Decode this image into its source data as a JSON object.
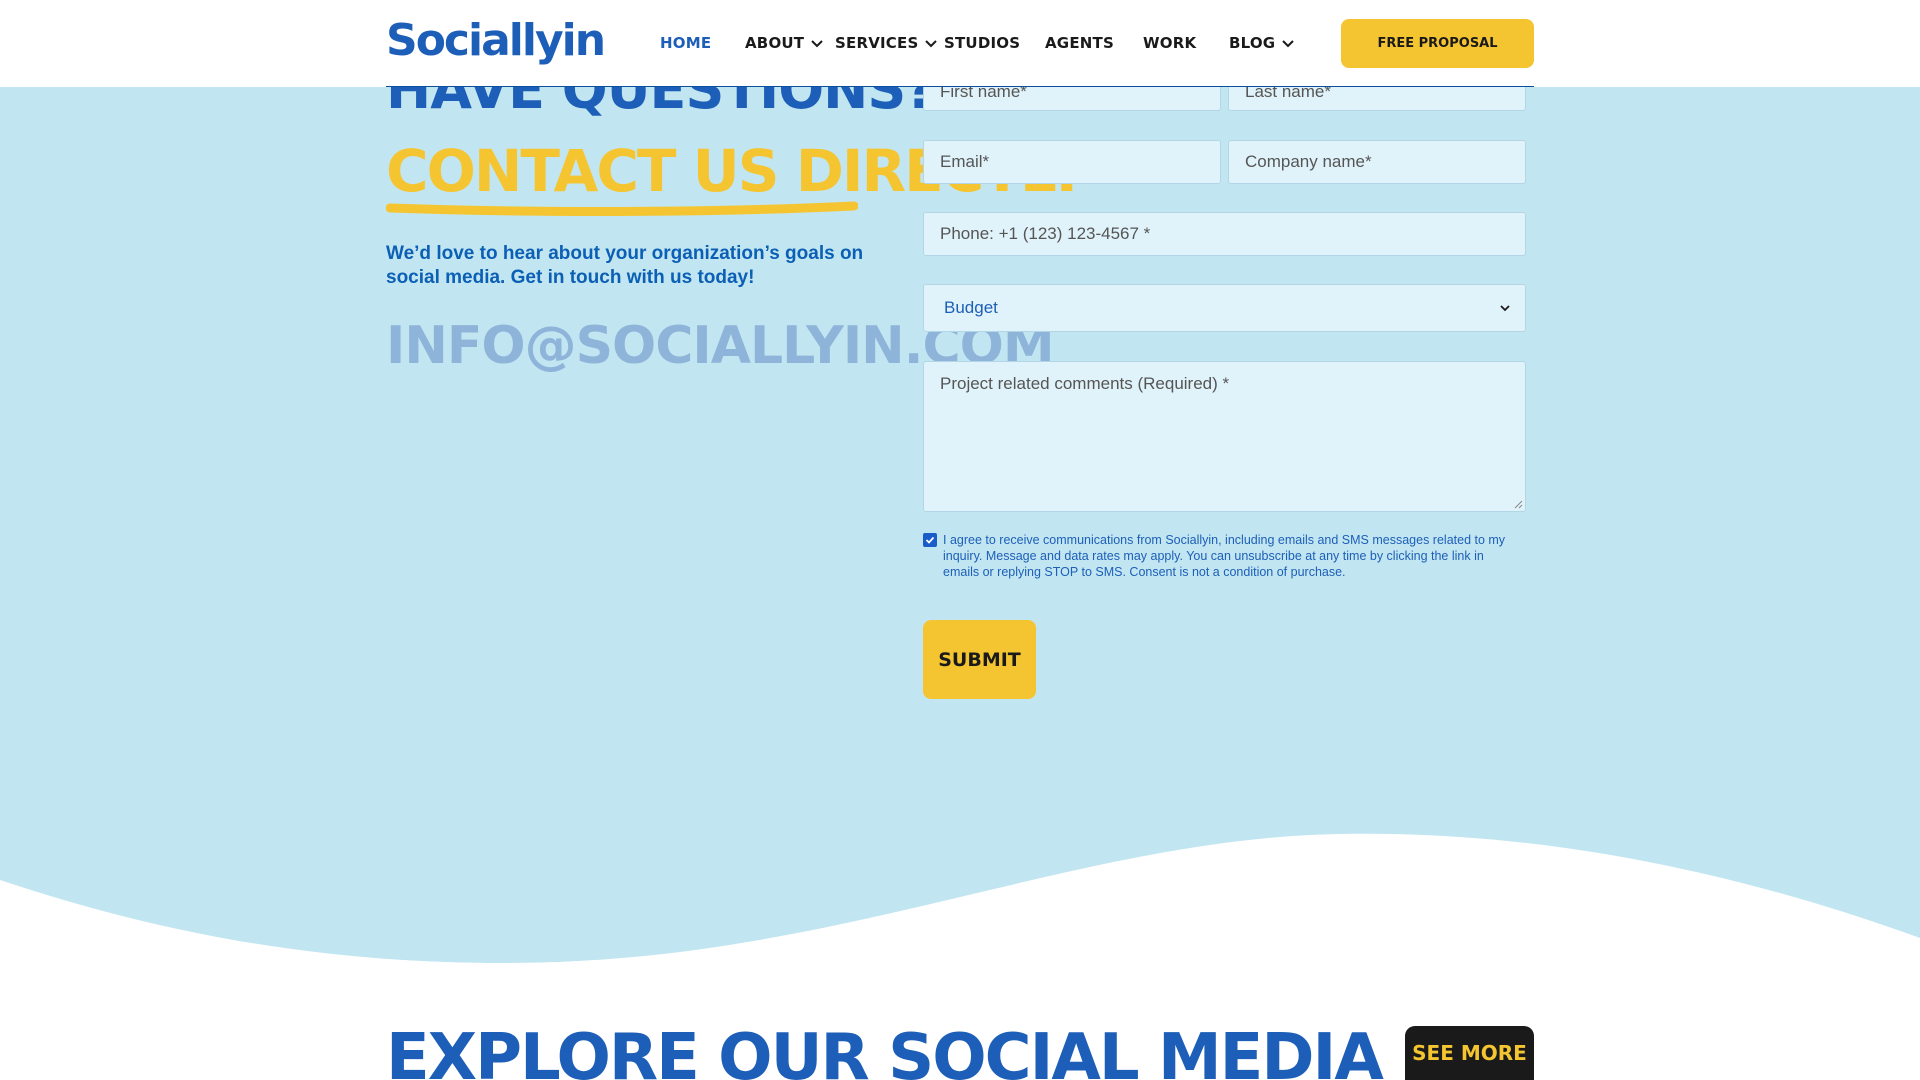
{
  "header": {
    "logo_text": "Sociallyin",
    "nav": [
      {
        "label": "HOME",
        "active": true,
        "dropdown": false
      },
      {
        "label": "ABOUT",
        "active": false,
        "dropdown": true
      },
      {
        "label": "SERVICES",
        "active": false,
        "dropdown": true
      },
      {
        "label": "STUDIOS",
        "active": false,
        "dropdown": false
      },
      {
        "label": "AGENTS",
        "active": false,
        "dropdown": false
      },
      {
        "label": "WORK",
        "active": false,
        "dropdown": false
      },
      {
        "label": "BLOG",
        "active": false,
        "dropdown": true
      }
    ],
    "cta_label": "FREE PROPOSAL"
  },
  "contact": {
    "heading_line1": "HAVE QUESTIONS?",
    "heading_line2": "CONTACT US DIRECTLY",
    "intro": "We’d love to hear about your organization’s goals on social media. Get in touch with us today!",
    "email": "INFO@SOCIALLYIN.COM"
  },
  "form": {
    "first_name_placeholder": "First name*",
    "last_name_placeholder": "Last name*",
    "email_placeholder": "Email*",
    "company_placeholder": "Company name*",
    "phone_placeholder": "Phone: +1 (123) 123-4567 *",
    "budget_selected": "Budget",
    "comments_placeholder": "Project related comments (Required) *",
    "consent_checked": true,
    "consent_text": "I agree to receive communications from Sociallyin, including emails and SMS messages related to my inquiry. Message and data rates may apply. You can unsubscribe at any time by clicking the link in emails or replying STOP to SMS. Consent is not a condition of purchase.",
    "submit_label": "SUBMIT"
  },
  "section2": {
    "title": "EXPLORE OUR SOCIAL MEDIA",
    "see_more_label": "SEE MORE"
  },
  "colors": {
    "brand_blue": "#1d5fb8",
    "accent_yellow": "#f5c531",
    "section_bg": "#c2e6f1",
    "email_muted": "#8fb4d9",
    "dark": "#1a1a1a"
  },
  "icons": {
    "dropdown": "chevron-down-icon",
    "select": "chevron-down-icon",
    "checkbox": "check-icon"
  }
}
